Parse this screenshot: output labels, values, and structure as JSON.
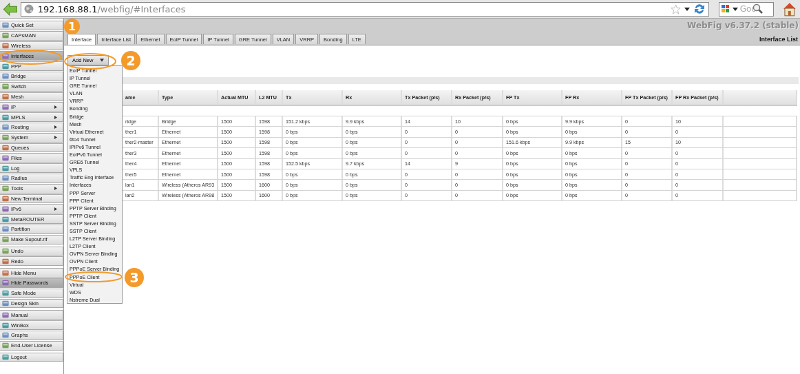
{
  "browser": {
    "url": {
      "host": "192.168.88.1",
      "path": "/webfig/#Interfaces"
    },
    "search": {
      "placeholder": "Goo"
    }
  },
  "sidebar": {
    "groups": [
      {
        "items": [
          {
            "label": "Quick Set",
            "submenu": false,
            "selected": false
          },
          {
            "label": "CAPsMAN",
            "submenu": false,
            "selected": false
          },
          {
            "label": "Wireless",
            "submenu": false,
            "selected": false
          },
          {
            "label": "Interfaces",
            "submenu": false,
            "selected": true
          },
          {
            "label": "PPP",
            "submenu": false,
            "selected": false
          },
          {
            "label": "Bridge",
            "submenu": false,
            "selected": false
          },
          {
            "label": "Switch",
            "submenu": false,
            "selected": false
          },
          {
            "label": "Mesh",
            "submenu": false,
            "selected": false
          },
          {
            "label": "IP",
            "submenu": true,
            "selected": false
          },
          {
            "label": "MPLS",
            "submenu": true,
            "selected": false
          },
          {
            "label": "Routing",
            "submenu": true,
            "selected": false
          },
          {
            "label": "System",
            "submenu": true,
            "selected": false
          },
          {
            "label": "Queues",
            "submenu": false,
            "selected": false
          },
          {
            "label": "Files",
            "submenu": false,
            "selected": false
          },
          {
            "label": "Log",
            "submenu": false,
            "selected": false
          },
          {
            "label": "Radius",
            "submenu": false,
            "selected": false
          },
          {
            "label": "Tools",
            "submenu": true,
            "selected": false
          },
          {
            "label": "New Terminal",
            "submenu": false,
            "selected": false
          },
          {
            "label": "IPv6",
            "submenu": true,
            "selected": false
          },
          {
            "label": "MetaROUTER",
            "submenu": false,
            "selected": false
          },
          {
            "label": "Partition",
            "submenu": false,
            "selected": false
          },
          {
            "label": "Make Supout.rif",
            "submenu": false,
            "selected": false
          }
        ]
      },
      {
        "items": [
          {
            "label": "Undo",
            "submenu": false,
            "selected": false
          },
          {
            "label": "Redo",
            "submenu": false,
            "selected": false
          }
        ]
      },
      {
        "items": [
          {
            "label": "Hide Menu",
            "submenu": false,
            "selected": false
          },
          {
            "label": "Hide Passwords",
            "submenu": false,
            "selected": true
          },
          {
            "label": "Safe Mode",
            "submenu": false,
            "selected": false
          },
          {
            "label": "Design Skin",
            "submenu": false,
            "selected": false
          }
        ]
      },
      {
        "items": [
          {
            "label": "Manual",
            "submenu": false,
            "selected": false
          },
          {
            "label": "WinBox",
            "submenu": false,
            "selected": false
          },
          {
            "label": "Graphs",
            "submenu": false,
            "selected": false
          },
          {
            "label": "End-User License",
            "submenu": false,
            "selected": false
          }
        ]
      },
      {
        "items": [
          {
            "label": "Logout",
            "submenu": false,
            "selected": false
          }
        ]
      }
    ]
  },
  "header": {
    "version": "WebFig v6.37.2 (stable)",
    "page_title": "Interface List"
  },
  "tabs": [
    {
      "label": "Interface",
      "selected": true
    },
    {
      "label": "Interface List",
      "selected": false
    },
    {
      "label": "Ethernet",
      "selected": false
    },
    {
      "label": "EoIP Tunnel",
      "selected": false
    },
    {
      "label": "IP Tunnel",
      "selected": false
    },
    {
      "label": "GRE Tunnel",
      "selected": false
    },
    {
      "label": "VLAN",
      "selected": false
    },
    {
      "label": "VRRP",
      "selected": false
    },
    {
      "label": "Bonding",
      "selected": false
    },
    {
      "label": "LTE",
      "selected": false
    }
  ],
  "add_new": {
    "label": "Add New"
  },
  "dropdown": {
    "items": [
      "EoIP Tunnel",
      "IP Tunnel",
      "GRE Tunnel",
      "VLAN",
      "VRRP",
      "Bonding",
      "Bridge",
      "Mesh",
      "Virtual Ethernet",
      "6to4 Tunnel",
      "IPIPv6 Tunnel",
      "EoIPv6 Tunnel",
      "GRE6 Tunnel",
      "VPLS",
      "Traffic Eng Interface",
      "Interfaces",
      "PPP Server",
      "PPP Client",
      "PPTP Server Binding",
      "PPTP Client",
      "SSTP Server Binding",
      "SSTP Client",
      "L2TP Server Binding",
      "L2TP Client",
      "OVPN Server Binding",
      "OVPN Client",
      "PPPoE Server Binding",
      "PPPoE Client",
      "Virtual",
      "WDS",
      "Nstreme Dual"
    ]
  },
  "table": {
    "columns": [
      "ame",
      "Type",
      "Actual MTU",
      "L2 MTU",
      "Tx",
      "Rx",
      "Tx Packet (p/s)",
      "Rx Packet (p/s)",
      "FP Tx",
      "FP Rx",
      "FP Tx Packet (p/s)",
      "FP Rx Packet (p/s)"
    ],
    "rows": [
      {
        "cells": [
          "ridge",
          "Bridge",
          "1500",
          "1598",
          "151.2 kbps",
          "9.9 kbps",
          "14",
          "10",
          "0 bps",
          "9.9 kbps",
          "0",
          "10"
        ]
      },
      {
        "cells": [
          "ther1",
          "Ethernet",
          "1500",
          "1598",
          "0 bps",
          "0 bps",
          "0",
          "0",
          "0 bps",
          "0 bps",
          "0",
          "0"
        ]
      },
      {
        "cells": [
          "ther2-master",
          "Ethernet",
          "1500",
          "1598",
          "0 bps",
          "0 bps",
          "0",
          "0",
          "151.6 kbps",
          "9.9 kbps",
          "15",
          "10"
        ]
      },
      {
        "cells": [
          "ther3",
          "Ethernet",
          "1500",
          "1598",
          "0 bps",
          "0 bps",
          "0",
          "0",
          "0 bps",
          "0 bps",
          "0",
          "0"
        ]
      },
      {
        "cells": [
          "ther4",
          "Ethernet",
          "1500",
          "1598",
          "152.5 kbps",
          "9.7 kbps",
          "14",
          "9",
          "0 bps",
          "0 bps",
          "0",
          "0"
        ]
      },
      {
        "cells": [
          "ther5",
          "Ethernet",
          "1500",
          "1598",
          "0 bps",
          "0 bps",
          "0",
          "0",
          "0 bps",
          "0 bps",
          "0",
          "0"
        ]
      },
      {
        "cells": [
          "lan1",
          "Wireless (Atheros AR93",
          "1500",
          "1600",
          "0 bps",
          "0 bps",
          "0",
          "0",
          "0 bps",
          "0 bps",
          "0",
          "0"
        ]
      },
      {
        "cells": [
          "lan2",
          "Wireless (Atheros AR98",
          "1500",
          "1600",
          "0 bps",
          "0 bps",
          "0",
          "0",
          "0 bps",
          "0 bps",
          "0",
          "0"
        ]
      }
    ]
  },
  "annotations": [
    {
      "label": "1"
    },
    {
      "label": "2"
    },
    {
      "label": "3"
    }
  ]
}
